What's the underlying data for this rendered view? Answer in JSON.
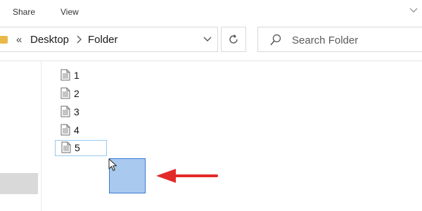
{
  "ribbon": {
    "tabs": [
      {
        "label": "Share"
      },
      {
        "label": "View"
      }
    ]
  },
  "address_bar": {
    "overflow": "«",
    "breadcrumbs": [
      "Desktop",
      "Folder"
    ]
  },
  "search": {
    "placeholder": "Search Folder"
  },
  "files": [
    {
      "name": "1"
    },
    {
      "name": "2"
    },
    {
      "name": "3"
    },
    {
      "name": "4"
    },
    {
      "name": "5",
      "focused": true
    }
  ],
  "annotation": {
    "arrow_color": "#e32a2a"
  },
  "colors": {
    "selection_fill": "#a9c9ef",
    "selection_border": "#3a7bd5",
    "focus_border": "#99c9ef"
  },
  "icons": {
    "file": "document-icon",
    "refresh": "refresh-icon",
    "search": "search-icon",
    "ribbon_expand": "chevron-down-icon"
  }
}
